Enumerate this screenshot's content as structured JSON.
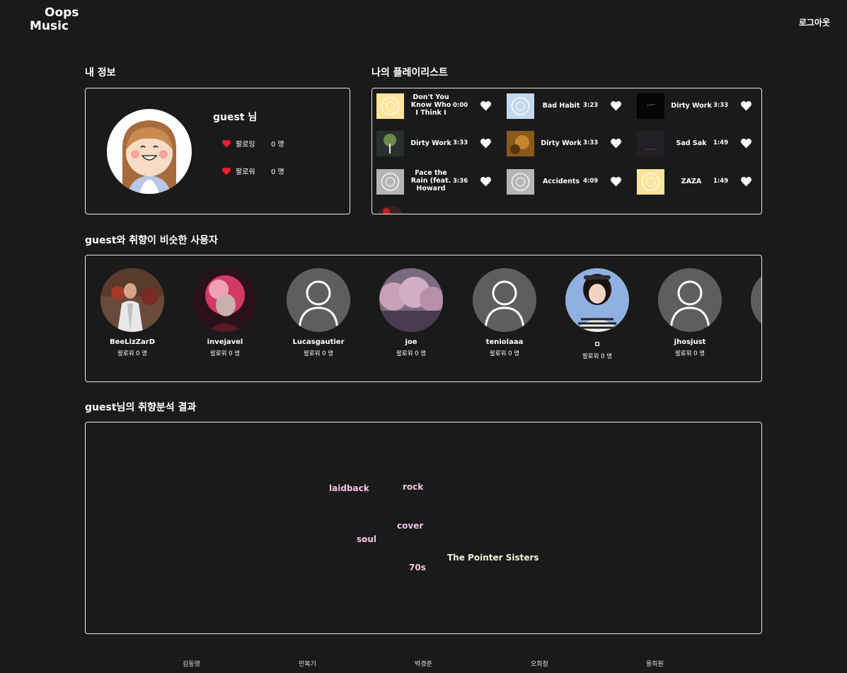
{
  "header": {
    "logo_line1": "Oops",
    "logo_line2": "Music",
    "logout": "로그아웃"
  },
  "info": {
    "title": "내 정보",
    "name": "guest 님",
    "following_label": "팔로잉",
    "following_value": "0 명",
    "followers_label": "팔로워",
    "followers_value": "0 명"
  },
  "playlist": {
    "title": "나의 플레이리스트",
    "tracks": [
      {
        "title": "Don't You Know Who I Think I",
        "duration": "0:00"
      },
      {
        "title": "Bad Habit",
        "duration": "3:23"
      },
      {
        "title": "Dirty Work",
        "duration": "3:33"
      },
      {
        "title": "Dirty Work",
        "duration": "3:33"
      },
      {
        "title": "Dirty Work",
        "duration": "3:33"
      },
      {
        "title": "Sad Sak",
        "duration": "1:49"
      },
      {
        "title": "Face the Rain (feat. Howard",
        "duration": "3:36"
      },
      {
        "title": "Accidents",
        "duration": "4:09"
      },
      {
        "title": "ZAZA",
        "duration": "1:49"
      }
    ]
  },
  "similar": {
    "title": "guest와 취향이 비슷한 사용자",
    "users": [
      {
        "name": "BeeLizZarD",
        "followers": "팔로워 0 명"
      },
      {
        "name": "invejavel",
        "followers": "팔로워 0 명"
      },
      {
        "name": "Lucasgautier",
        "followers": "팔로워 0 명"
      },
      {
        "name": "joe",
        "followers": "팔로워 0 명"
      },
      {
        "name": "teniolaaa",
        "followers": "팔로워 0 명"
      },
      {
        "name": "ㅁ",
        "followers": "팔로워 0 명"
      },
      {
        "name": "jhosjust",
        "followers": "팔로워 0 명"
      }
    ]
  },
  "analysis": {
    "title": "guest님의 취향분석 결과",
    "tags": [
      "laidback",
      "rock",
      "cover",
      "soul",
      "The Pointer Sisters",
      "70s"
    ]
  },
  "footer": {
    "names": [
      "김동영",
      "민복기",
      "박경준",
      "오희정",
      "용희원"
    ]
  },
  "colors": {
    "background": "#1a1a1a",
    "heart_red": "#e8202a",
    "tag_pink": "#f2c4e0",
    "tag_green": "#eaf3d6"
  }
}
